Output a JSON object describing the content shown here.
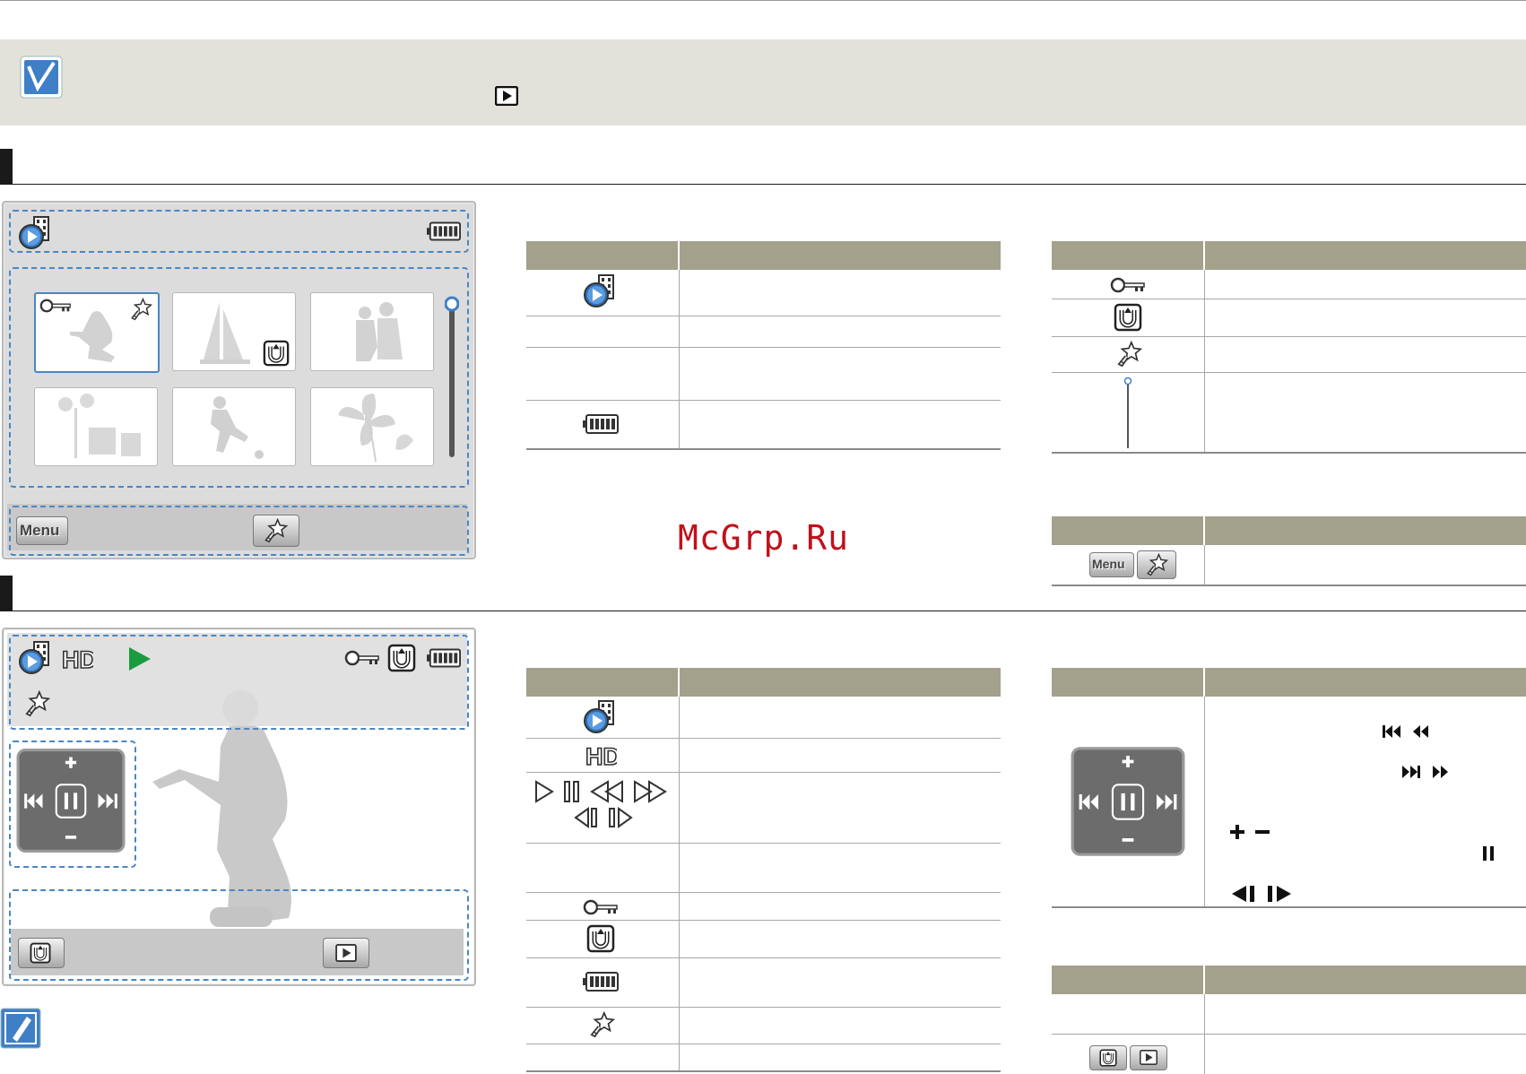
{
  "watermark": "McGrp.Ru",
  "thumbnail_screen": {
    "menu_button_label": "Menu"
  },
  "playback_screen": {
    "quality_label": "HD"
  },
  "right_table_menu_label": "Menu",
  "colors": {
    "accent_blue": "#4a86c5",
    "table_header": "#a3a18c",
    "play_green": "#1a9c3e",
    "watermark_red": "#c0111b"
  },
  "icons": [
    "checkmark-icon",
    "playback-mode-icon",
    "battery-icon",
    "protect-key-icon",
    "story-board-icon",
    "smart-auto-icon",
    "scroll-bar-icon",
    "menu-button-icon",
    "play-icon",
    "pause-icon",
    "rewind-icon",
    "fast-forward-icon",
    "skip-back-icon",
    "skip-forward-icon",
    "note-icon"
  ]
}
